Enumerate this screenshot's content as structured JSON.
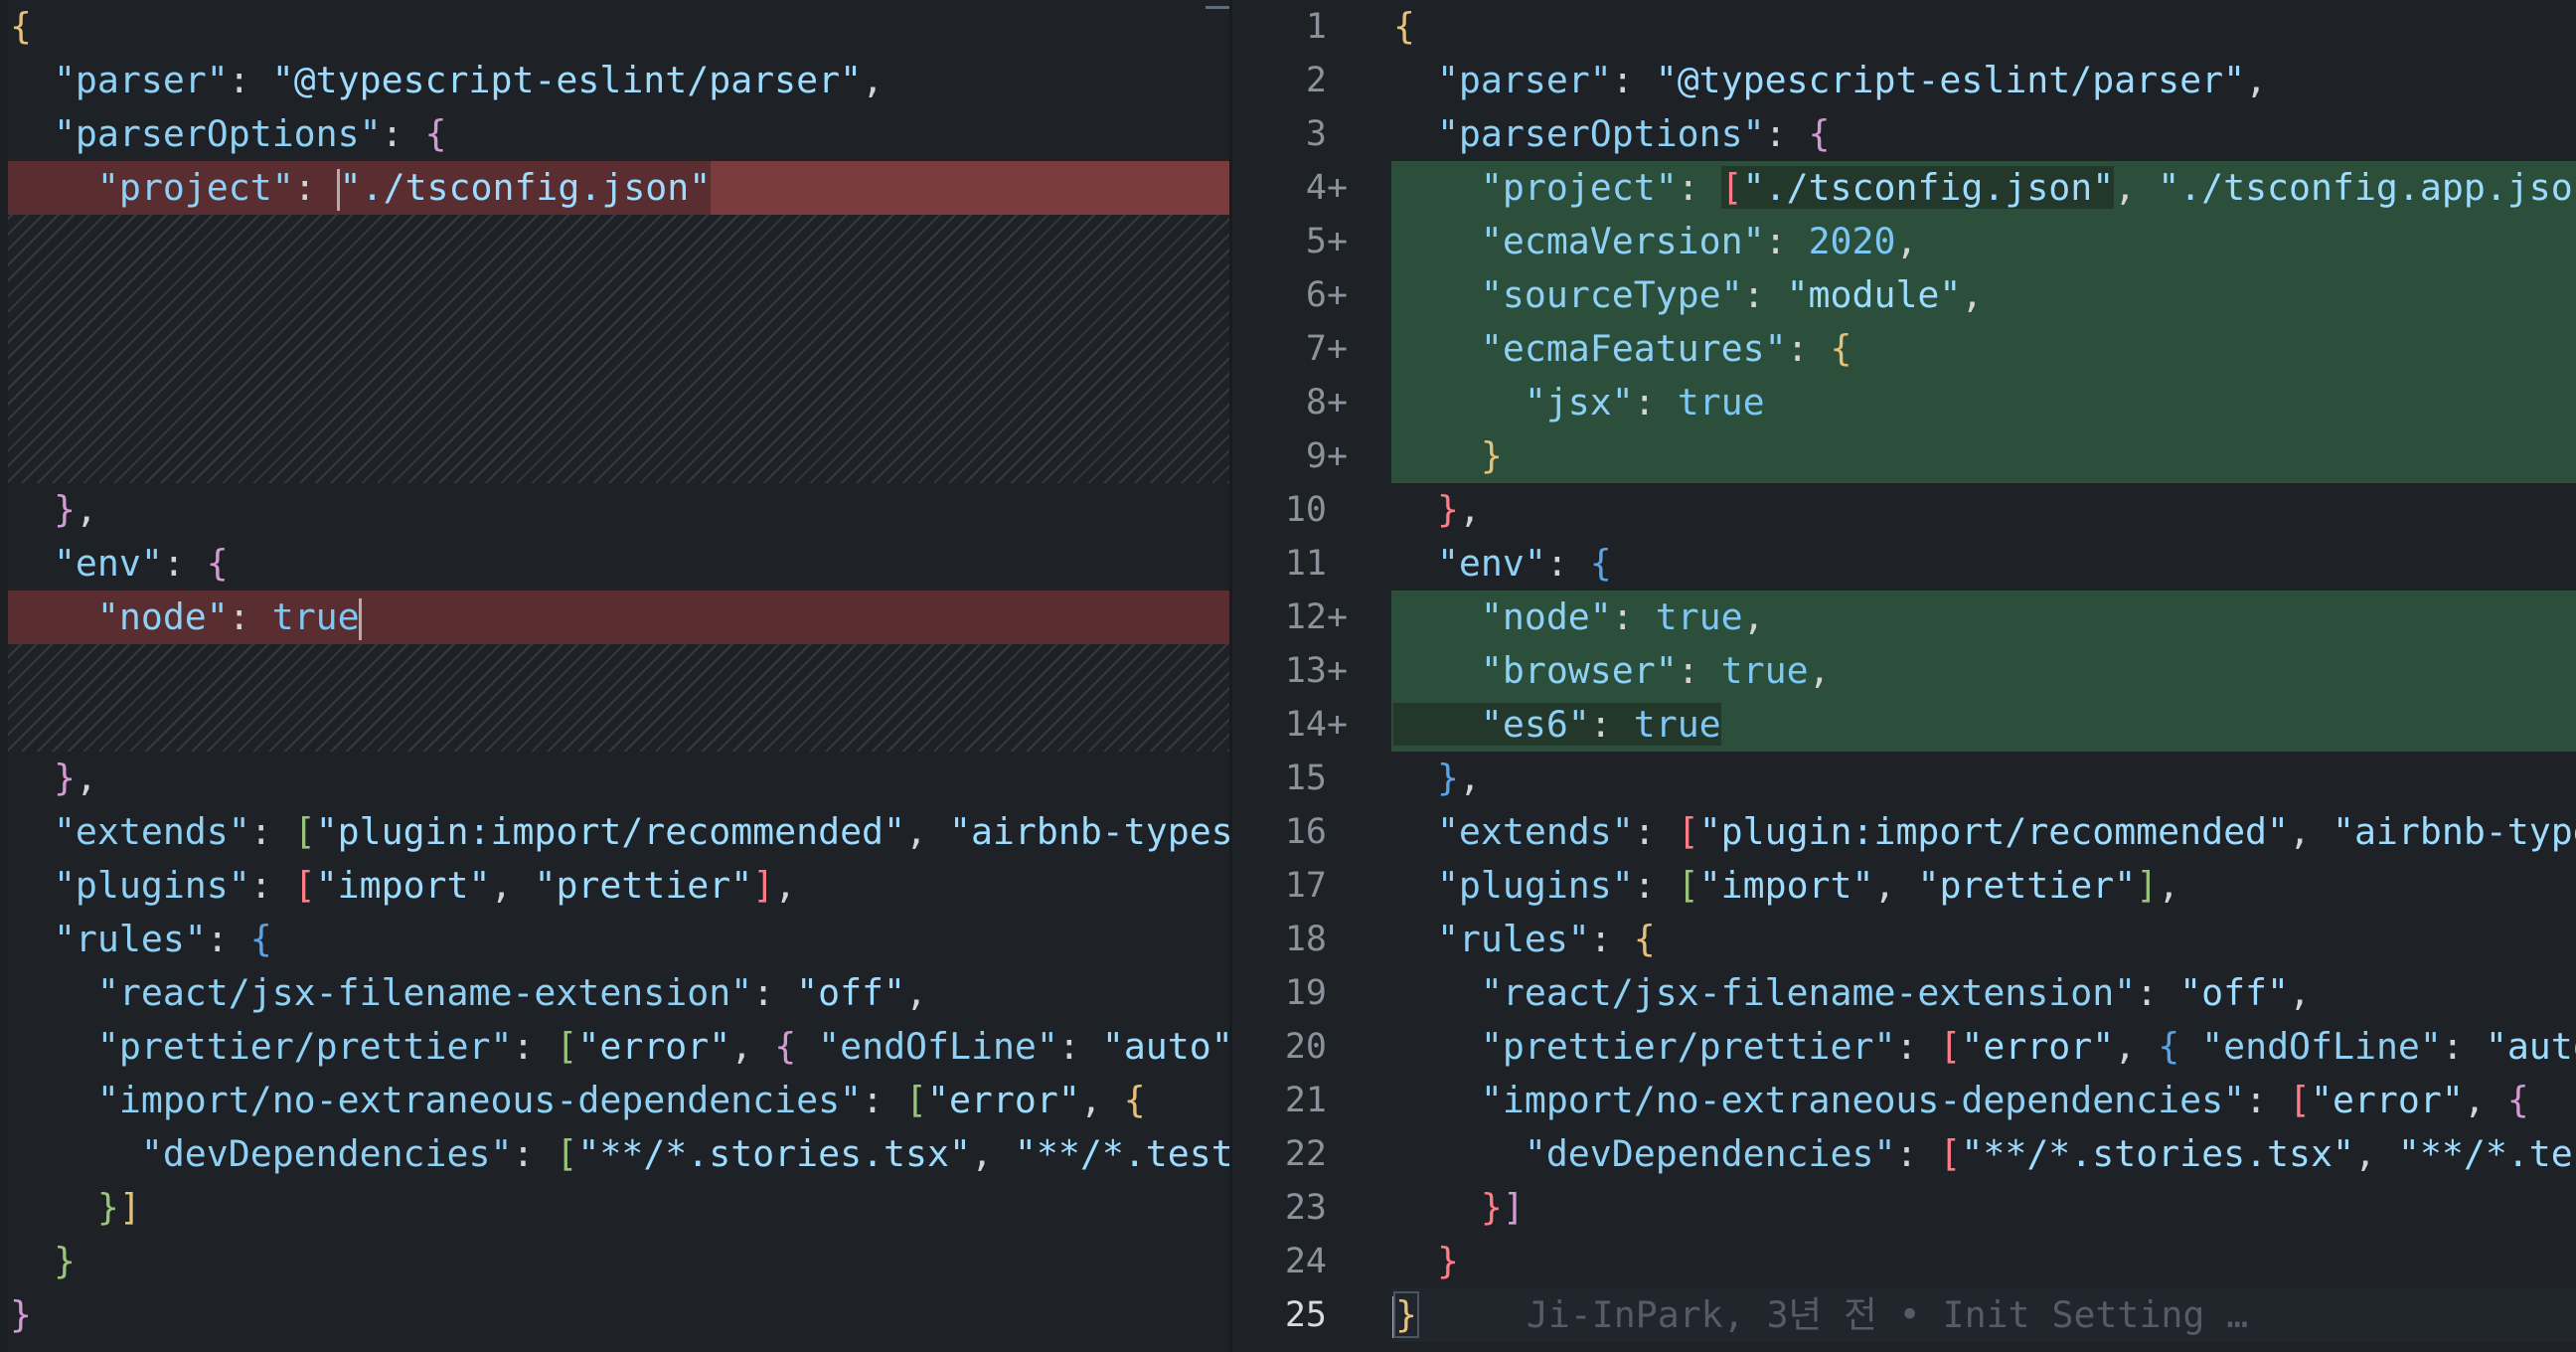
{
  "editor": {
    "view": "side-by-side diff",
    "colors": {
      "background": "#1e2227",
      "removed_line": "#5a2e31",
      "added_line": "#2c4f3b",
      "key": "#8fd0f5",
      "string": "#9ddcff",
      "boolean_number": "#7cc7f3"
    }
  },
  "original": {
    "lines": [
      {
        "text": "{",
        "type": "normal"
      },
      {
        "text": "  \"parser\": \"@typescript-eslint/parser\",",
        "type": "normal"
      },
      {
        "text": "  \"parserOptions\": {",
        "type": "normal"
      },
      {
        "text": "    \"project\": \"./tsconfig.json\"",
        "type": "removed"
      },
      {
        "text": "  },",
        "type": "normal"
      },
      {
        "text": "  \"env\": {",
        "type": "normal"
      },
      {
        "text": "    \"node\": true",
        "type": "removed"
      },
      {
        "text": "  },",
        "type": "normal"
      },
      {
        "text": "  \"extends\": [\"plugin:import/recommended\", \"airbnb-typesc",
        "type": "normal"
      },
      {
        "text": "  \"plugins\": [\"import\", \"prettier\"],",
        "type": "normal"
      },
      {
        "text": "  \"rules\": {",
        "type": "normal"
      },
      {
        "text": "    \"react/jsx-filename-extension\": \"off\",",
        "type": "normal"
      },
      {
        "text": "    \"prettier/prettier\": [\"error\", { \"endOfLine\": \"auto\"",
        "type": "normal"
      },
      {
        "text": "    \"import/no-extraneous-dependencies\": [\"error\", {",
        "type": "normal"
      },
      {
        "text": "      \"devDependencies\": [\"**/*.stories.tsx\", \"**/*.test.",
        "type": "normal"
      },
      {
        "text": "    }]",
        "type": "normal"
      },
      {
        "text": "  }",
        "type": "normal"
      },
      {
        "text": "}",
        "type": "normal"
      }
    ]
  },
  "modified": {
    "line_numbers": [
      "1",
      "2",
      "3",
      "4",
      "5",
      "6",
      "7",
      "8",
      "9",
      "10",
      "11",
      "12",
      "13",
      "14",
      "15",
      "16",
      "17",
      "18",
      "19",
      "20",
      "21",
      "22",
      "23",
      "24",
      "25"
    ],
    "added_marker": "+",
    "lines": [
      {
        "text": "{",
        "type": "normal"
      },
      {
        "text": "  \"parser\": \"@typescript-eslint/parser\",",
        "type": "normal"
      },
      {
        "text": "  \"parserOptions\": {",
        "type": "normal"
      },
      {
        "text": "    \"project\": [\"./tsconfig.json\", \"./tsconfig.app.json",
        "type": "added"
      },
      {
        "text": "    \"ecmaVersion\": 2020,",
        "type": "added"
      },
      {
        "text": "    \"sourceType\": \"module\",",
        "type": "added"
      },
      {
        "text": "    \"ecmaFeatures\": {",
        "type": "added"
      },
      {
        "text": "      \"jsx\": true",
        "type": "added"
      },
      {
        "text": "    }",
        "type": "added"
      },
      {
        "text": "  },",
        "type": "normal"
      },
      {
        "text": "  \"env\": {",
        "type": "normal"
      },
      {
        "text": "    \"node\": true,",
        "type": "added"
      },
      {
        "text": "    \"browser\": true,",
        "type": "added"
      },
      {
        "text": "    \"es6\": true",
        "type": "added"
      },
      {
        "text": "  },",
        "type": "normal"
      },
      {
        "text": "  \"extends\": [\"plugin:import/recommended\", \"airbnb-type",
        "type": "normal"
      },
      {
        "text": "  \"plugins\": [\"import\", \"prettier\"],",
        "type": "normal"
      },
      {
        "text": "  \"rules\": {",
        "type": "normal"
      },
      {
        "text": "    \"react/jsx-filename-extension\": \"off\",",
        "type": "normal"
      },
      {
        "text": "    \"prettier/prettier\": [\"error\", { \"endOfLine\": \"auto",
        "type": "normal"
      },
      {
        "text": "    \"import/no-extraneous-dependencies\": [\"error\", {",
        "type": "normal"
      },
      {
        "text": "      \"devDependencies\": [\"**/*.stories.tsx\", \"**/*.tes",
        "type": "normal"
      },
      {
        "text": "    }]",
        "type": "normal"
      },
      {
        "text": "  }",
        "type": "normal"
      },
      {
        "text": "}",
        "type": "current"
      }
    ],
    "blame": "Ji-InPark, 3년 전 • Init Setting …"
  }
}
